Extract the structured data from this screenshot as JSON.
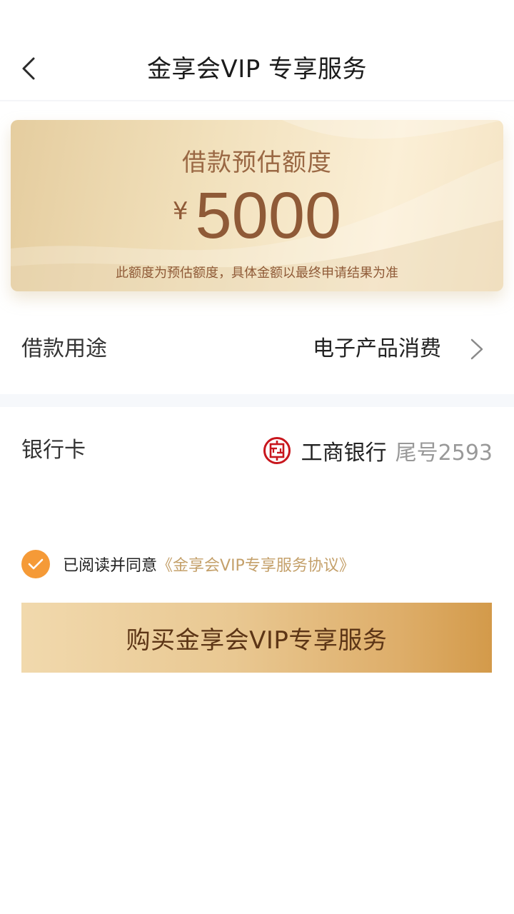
{
  "header": {
    "title": "金享会VIP 专享服务",
    "back_icon": "chevron-left-icon"
  },
  "quota_card": {
    "label": "借款预估额度",
    "currency": "¥",
    "amount": "5000",
    "note": "此额度为预估额度，具体金额以最终申请结果为准"
  },
  "purpose": {
    "label": "借款用途",
    "value": "电子产品消费",
    "chevron_icon": "chevron-right-icon"
  },
  "bank_card": {
    "label": "银行卡",
    "bank_icon": "icbc-logo-icon",
    "bank_name": "工商银行",
    "tail": "尾号2593"
  },
  "agreement": {
    "checked": true,
    "prefix": "已阅读并同意",
    "link": "《金享会VIP专享服务协议》"
  },
  "buy_button": {
    "label": "购买金享会VIP专享服务"
  },
  "colors": {
    "check": "#f59a37",
    "link": "#c4a06a",
    "amount": "#8f5a37",
    "button_text": "#5c3516"
  }
}
